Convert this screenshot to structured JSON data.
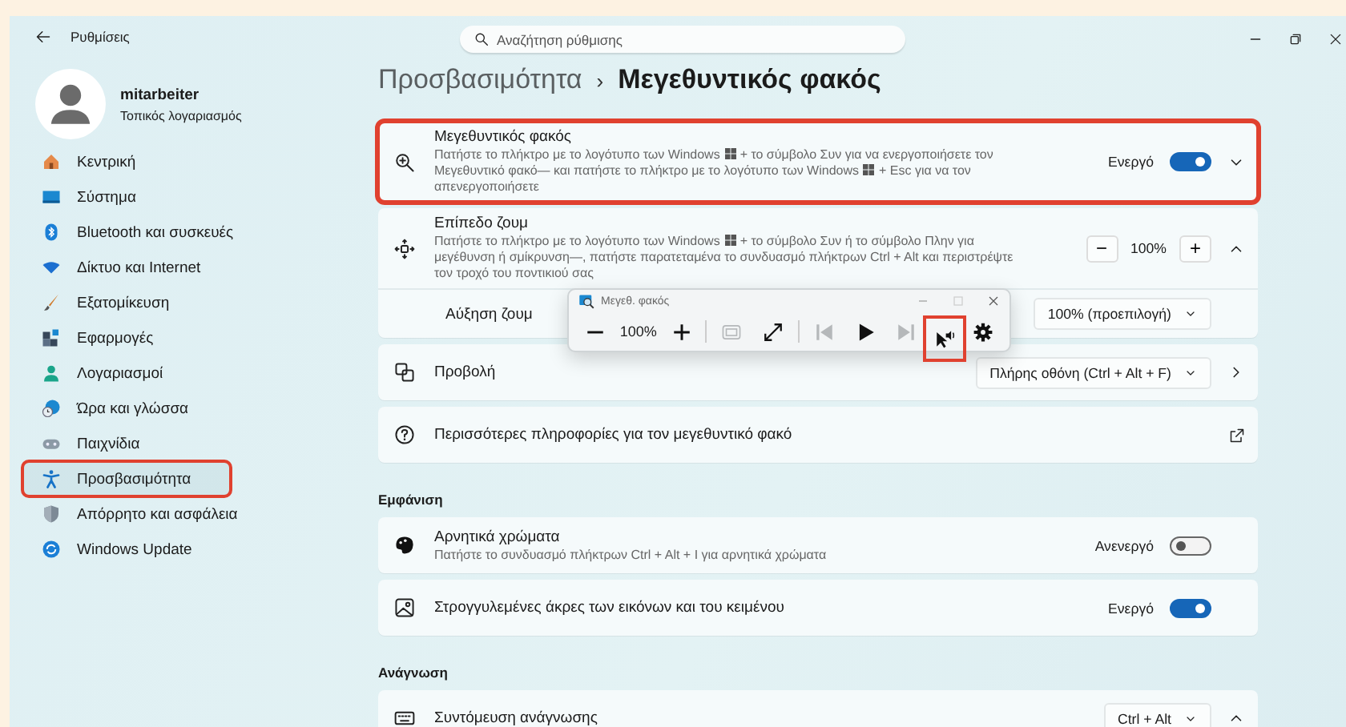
{
  "window": {
    "title": "Ρυθμίσεις"
  },
  "search": {
    "placeholder": "Αναζήτηση ρύθμισης"
  },
  "account": {
    "name": "mitarbeiter",
    "type": "Τοπικός λογαριασμός"
  },
  "sidebar": {
    "items": [
      {
        "label": "Κεντρική",
        "selected": false,
        "highlighted": false
      },
      {
        "label": "Σύστημα",
        "selected": false,
        "highlighted": false
      },
      {
        "label": "Bluetooth και συσκευές",
        "selected": false,
        "highlighted": false
      },
      {
        "label": "Δίκτυο και Internet",
        "selected": false,
        "highlighted": false
      },
      {
        "label": "Εξατομίκευση",
        "selected": false,
        "highlighted": false
      },
      {
        "label": "Εφαρμογές",
        "selected": false,
        "highlighted": false
      },
      {
        "label": "Λογαριασμοί",
        "selected": false,
        "highlighted": false
      },
      {
        "label": "Ώρα και γλώσσα",
        "selected": false,
        "highlighted": false
      },
      {
        "label": "Παιχνίδια",
        "selected": false,
        "highlighted": false
      },
      {
        "label": "Προσβασιμότητα",
        "selected": true,
        "highlighted": true
      },
      {
        "label": "Απόρρητο και ασφάλεια",
        "selected": false,
        "highlighted": false
      },
      {
        "label": "Windows Update",
        "selected": false,
        "highlighted": false
      }
    ]
  },
  "breadcrumb": {
    "parent": "Προσβασιμότητα",
    "separator": "›",
    "current": "Μεγεθυντικός φακός"
  },
  "sections": [
    {
      "cards": [
        {
          "kind": "toggle",
          "title": "Μεγεθυντικός φακός",
          "description": [
            "Πατήστε το πλήκτρο με το λογότυπο των Windows",
            "+ το σύμβολο Συν για να ενεργοποιήσετε τον Μεγεθυντικό φακό— και πατήστε το πλήκτρο με το λογότυπο των Windows",
            "+ Esc για να τον απενεργοποιήσετε"
          ],
          "state": "Ενεργό",
          "on": true,
          "expanded": false,
          "highlighted": true
        },
        {
          "kind": "stepper",
          "title": "Επίπεδο ζουμ",
          "description": [
            "Πατήστε το πλήκτρο με το λογότυπο των Windows",
            "+ το σύμβολο Συν ή το σύμβολο Πλην για μεγέθυνση ή σμίκρυνση—, πατήστε παρατεταμένα το συνδυασμό πλήκτρων Ctrl + Alt και περιστρέψτε τον τροχό του ποντικιού σας"
          ],
          "minus": "−",
          "value": "100%",
          "plus": "+",
          "expanded": true,
          "highlighted": false,
          "sub": [
            {
              "label": "Αύξηση ζουμ",
              "value": "100% (προεπιλογή)"
            }
          ]
        },
        {
          "kind": "dropdown",
          "title": "Προβολή",
          "value": "Πλήρης οθόνη (Ctrl + Alt + F)",
          "highlighted": false
        },
        {
          "kind": "link",
          "title": "Περισσότερες πληροφορίες για τον μεγεθυντικό φακό",
          "highlighted": false
        }
      ]
    },
    {
      "heading": "Εμφάνιση",
      "cards": [
        {
          "kind": "toggle",
          "title": "Αρνητικά χρώματα",
          "description": [
            "Πατήστε το συνδυασμό πλήκτρων Ctrl + Alt + I για αρνητικά χρώματα"
          ],
          "state": "Ανενεργό",
          "on": false,
          "highlighted": false
        },
        {
          "kind": "toggle",
          "title": "Στρογγυλεμένες άκρες των εικόνων και του κειμένου",
          "state": "Ενεργό",
          "on": true,
          "highlighted": false
        }
      ]
    },
    {
      "heading": "Ανάγνωση",
      "cards": [
        {
          "kind": "dropdown",
          "title": "Συντόμευση ανάγνωσης",
          "value": "Ctrl + Alt",
          "expanded": true,
          "highlighted": false
        }
      ]
    }
  ],
  "magnifier": {
    "title": "Μεγεθ. φακός",
    "zoom": "100%",
    "tools": [
      {
        "kind": "zoom-out",
        "disabled": false,
        "highlighted": false
      },
      {
        "kind": "zoom-value"
      },
      {
        "kind": "zoom-in",
        "disabled": false,
        "highlighted": false
      },
      {
        "kind": "separator"
      },
      {
        "kind": "fit",
        "disabled": true,
        "highlighted": false
      },
      {
        "kind": "expand",
        "disabled": false,
        "highlighted": false
      },
      {
        "kind": "separator"
      },
      {
        "kind": "previous",
        "disabled": true,
        "highlighted": false
      },
      {
        "kind": "play",
        "disabled": false,
        "highlighted": false
      },
      {
        "kind": "next",
        "disabled": true,
        "highlighted": false
      },
      {
        "kind": "read-from-pointer",
        "disabled": false,
        "highlighted": true
      },
      {
        "kind": "settings",
        "disabled": false,
        "highlighted": false
      }
    ]
  }
}
